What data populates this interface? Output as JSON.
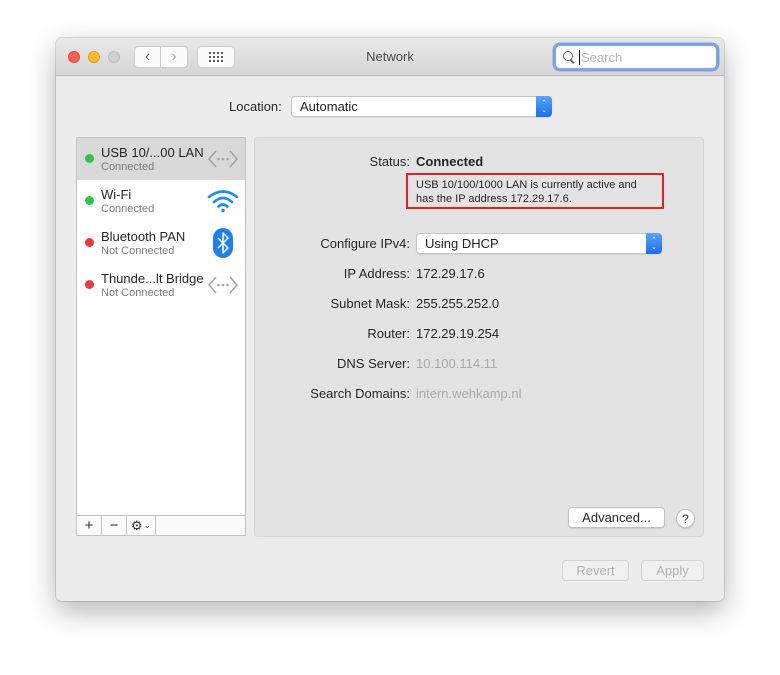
{
  "window": {
    "title": "Network",
    "search": {
      "placeholder": "Search",
      "value": ""
    },
    "nav": {
      "back_icon": "chevron-left-icon",
      "forward_icon": "chevron-right-icon",
      "grid_icon": "show-all-grid-icon"
    }
  },
  "location": {
    "label": "Location:",
    "value": "Automatic"
  },
  "sidebar": {
    "services": [
      {
        "name": "USB 10/...00 LAN",
        "status": "Connected",
        "status_color": "#2dc543",
        "icon": "ethernet-icon",
        "selected": true
      },
      {
        "name": "Wi-Fi",
        "status": "Connected",
        "status_color": "#2dc543",
        "icon": "wifi-icon",
        "selected": false
      },
      {
        "name": "Bluetooth PAN",
        "status": "Not Connected",
        "status_color": "#f0383a",
        "icon": "bluetooth-icon",
        "selected": false
      },
      {
        "name": "Thunde...lt Bridge",
        "status": "Not Connected",
        "status_color": "#f0383a",
        "icon": "ethernet-icon",
        "selected": false
      }
    ],
    "toolbar": {
      "add": "+",
      "remove": "−",
      "gear": "⚙"
    }
  },
  "detail": {
    "status_label": "Status:",
    "status_value": "Connected",
    "status_description": "USB 10/100/1000 LAN is currently active and has the IP address 172.29.17.6.",
    "configure_ipv4_label": "Configure IPv4:",
    "configure_ipv4_value": "Using DHCP",
    "ip_address_label": "IP Address:",
    "ip_address_value": "172.29.17.6",
    "subnet_mask_label": "Subnet Mask:",
    "subnet_mask_value": "255.255.252.0",
    "router_label": "Router:",
    "router_value": "172.29.19.254",
    "dns_server_label": "DNS Server:",
    "dns_server_value": "10.100.114.11",
    "search_domains_label": "Search Domains:",
    "search_domains_value": "intern.wehkamp.nl",
    "advanced_label": "Advanced...",
    "help_label": "?"
  },
  "footer": {
    "revert_label": "Revert",
    "apply_label": "Apply"
  },
  "colors": {
    "accent": "#1a6ef0",
    "highlight_box": "#e52222",
    "connected": "#2dc543",
    "not_connected": "#f0383a"
  }
}
